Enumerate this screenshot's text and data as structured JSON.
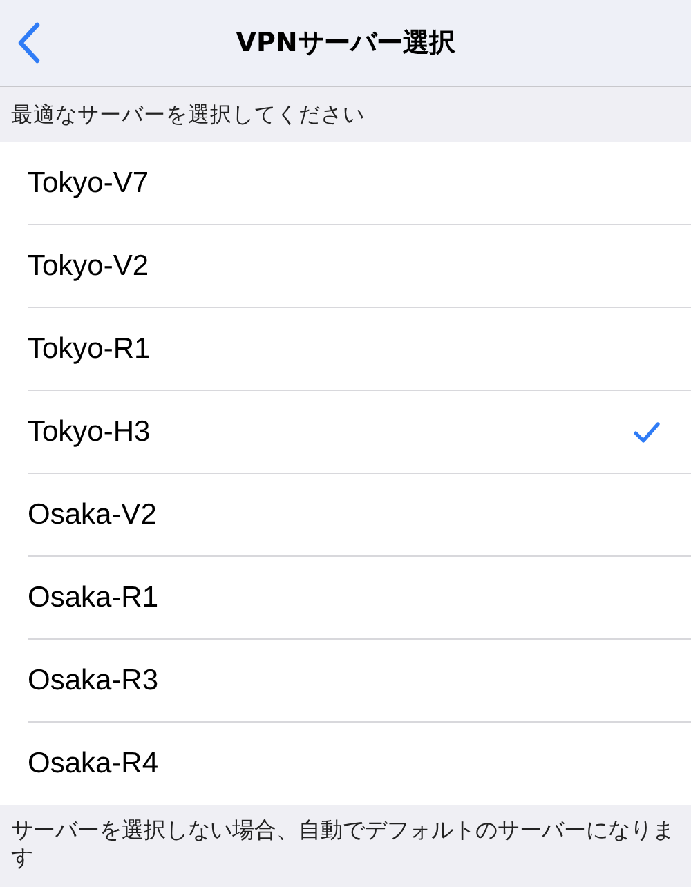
{
  "nav": {
    "title": "VPNサーバー選択"
  },
  "section_header": "最適なサーバーを選択してください",
  "servers": [
    {
      "name": "Tokyo-V7",
      "selected": false
    },
    {
      "name": "Tokyo-V2",
      "selected": false
    },
    {
      "name": "Tokyo-R1",
      "selected": false
    },
    {
      "name": "Tokyo-H3",
      "selected": true
    },
    {
      "name": "Osaka-V2",
      "selected": false
    },
    {
      "name": "Osaka-R1",
      "selected": false
    },
    {
      "name": "Osaka-R3",
      "selected": false
    },
    {
      "name": "Osaka-R4",
      "selected": false
    }
  ],
  "footer": "サーバーを選択しない場合、自動でデフォルトのサーバーになります"
}
